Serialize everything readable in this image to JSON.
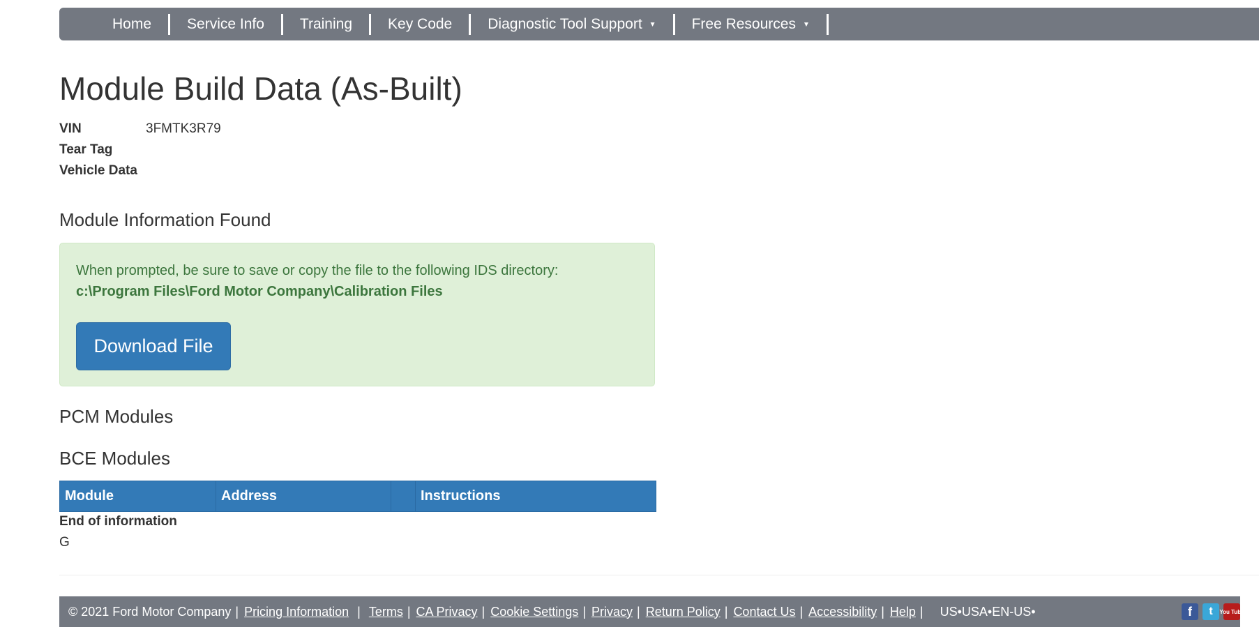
{
  "nav": {
    "items": [
      {
        "label": "Home"
      },
      {
        "label": "Service Info"
      },
      {
        "label": "Training"
      },
      {
        "label": "Key Code"
      },
      {
        "label": "Diagnostic Tool Support",
        "dropdown": true
      },
      {
        "label": "Free Resources",
        "dropdown": true
      }
    ],
    "caret": "▼"
  },
  "page": {
    "title": "Module Build Data (As-Built)"
  },
  "vehicle": {
    "vin_label": "VIN",
    "vin_value": "3FMTK3R79",
    "tear_tag_label": "Tear Tag",
    "vehicle_data_label": "Vehicle Data"
  },
  "module_info": {
    "heading": "Module Information Found",
    "alert_text": "When prompted, be sure to save or copy the file to the following IDS directory:",
    "alert_path": "c:\\Program Files\\Ford Motor Company\\Calibration Files",
    "download_label": "Download File"
  },
  "pcm": {
    "heading": "PCM Modules"
  },
  "bce": {
    "heading": "BCE Modules",
    "columns": [
      "Module",
      "Address",
      "",
      "Instructions"
    ],
    "end_text": "End of information",
    "trailing_text": "G"
  },
  "footer": {
    "copyright": "© 2021 Ford Motor Company",
    "links": [
      "Pricing Information",
      "Terms",
      "CA Privacy",
      "Cookie Settings",
      "Privacy",
      "Return Policy",
      "Contact Us",
      "Accessibility",
      "Help"
    ],
    "separator": "|",
    "locale": "US•USA•EN-US•",
    "social": {
      "facebook_glyph": "f",
      "twitter_glyph": "t",
      "youtube_glyph": "You Tube",
      "icons": [
        "facebook-icon",
        "twitter-icon",
        "youtube-icon"
      ]
    }
  },
  "colors": {
    "nav_bg": "#737881",
    "primary": "#337ab7",
    "alert_bg": "#dff0d8",
    "alert_text": "#3c763d"
  }
}
